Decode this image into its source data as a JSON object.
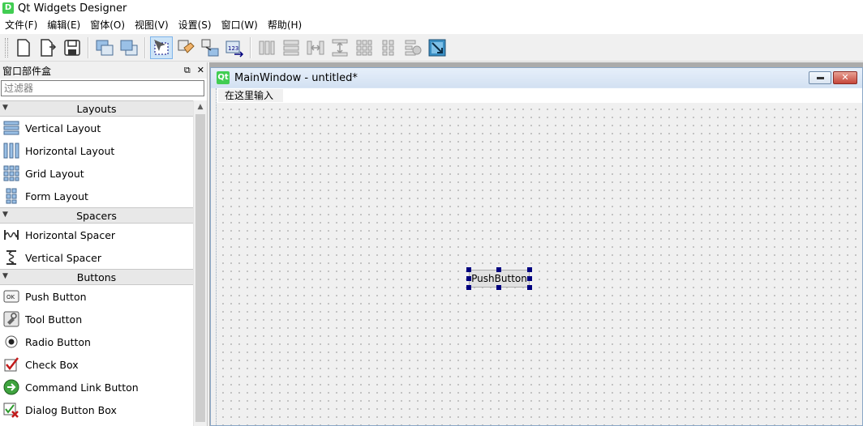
{
  "window": {
    "title": "Qt Widgets Designer",
    "icon_letter": "D"
  },
  "menubar": {
    "items": [
      "文件(F)",
      "编辑(E)",
      "窗体(O)",
      "视图(V)",
      "设置(S)",
      "窗口(W)",
      "帮助(H)"
    ]
  },
  "toolbar": {
    "buttons": [
      {
        "name": "new-form-icon"
      },
      {
        "name": "open-form-icon"
      },
      {
        "name": "save-form-icon"
      },
      {
        "name": "send-to-back-icon"
      },
      {
        "name": "bring-to-front-icon"
      },
      {
        "name": "edit-widgets-icon",
        "active": true
      },
      {
        "name": "edit-buddies-icon"
      },
      {
        "name": "edit-signals-slots-icon"
      },
      {
        "name": "edit-tab-order-icon"
      },
      {
        "name": "lay-out-horizontally-icon"
      },
      {
        "name": "lay-out-vertically-icon"
      },
      {
        "name": "lay-out-horizontal-splitter-icon"
      },
      {
        "name": "lay-out-vertical-splitter-icon"
      },
      {
        "name": "lay-out-grid-icon"
      },
      {
        "name": "lay-out-form-icon"
      },
      {
        "name": "break-layout-icon"
      },
      {
        "name": "adjust-size-icon"
      }
    ]
  },
  "widgetbox": {
    "title": "窗口部件盒",
    "filter_placeholder": "过滤器",
    "categories": [
      {
        "label": "Layouts",
        "items": [
          {
            "label": "Vertical Layout",
            "icon": "vertical-layout-icon"
          },
          {
            "label": "Horizontal Layout",
            "icon": "horizontal-layout-icon"
          },
          {
            "label": "Grid Layout",
            "icon": "grid-layout-icon"
          },
          {
            "label": "Form Layout",
            "icon": "form-layout-icon"
          }
        ]
      },
      {
        "label": "Spacers",
        "items": [
          {
            "label": "Horizontal Spacer",
            "icon": "horizontal-spacer-icon"
          },
          {
            "label": "Vertical Spacer",
            "icon": "vertical-spacer-icon"
          }
        ]
      },
      {
        "label": "Buttons",
        "items": [
          {
            "label": "Push Button",
            "icon": "push-button-icon"
          },
          {
            "label": "Tool Button",
            "icon": "tool-button-icon"
          },
          {
            "label": "Radio Button",
            "icon": "radio-button-icon"
          },
          {
            "label": "Check Box",
            "icon": "check-box-icon"
          },
          {
            "label": "Command Link Button",
            "icon": "command-link-icon"
          },
          {
            "label": "Dialog Button Box",
            "icon": "dialog-button-box-icon"
          }
        ]
      }
    ]
  },
  "form": {
    "window_title": "MainWindow - untitled*",
    "qt_badge": "Qt",
    "menu_placeholder": "在这里输入",
    "push_button_label": "PushButton"
  }
}
